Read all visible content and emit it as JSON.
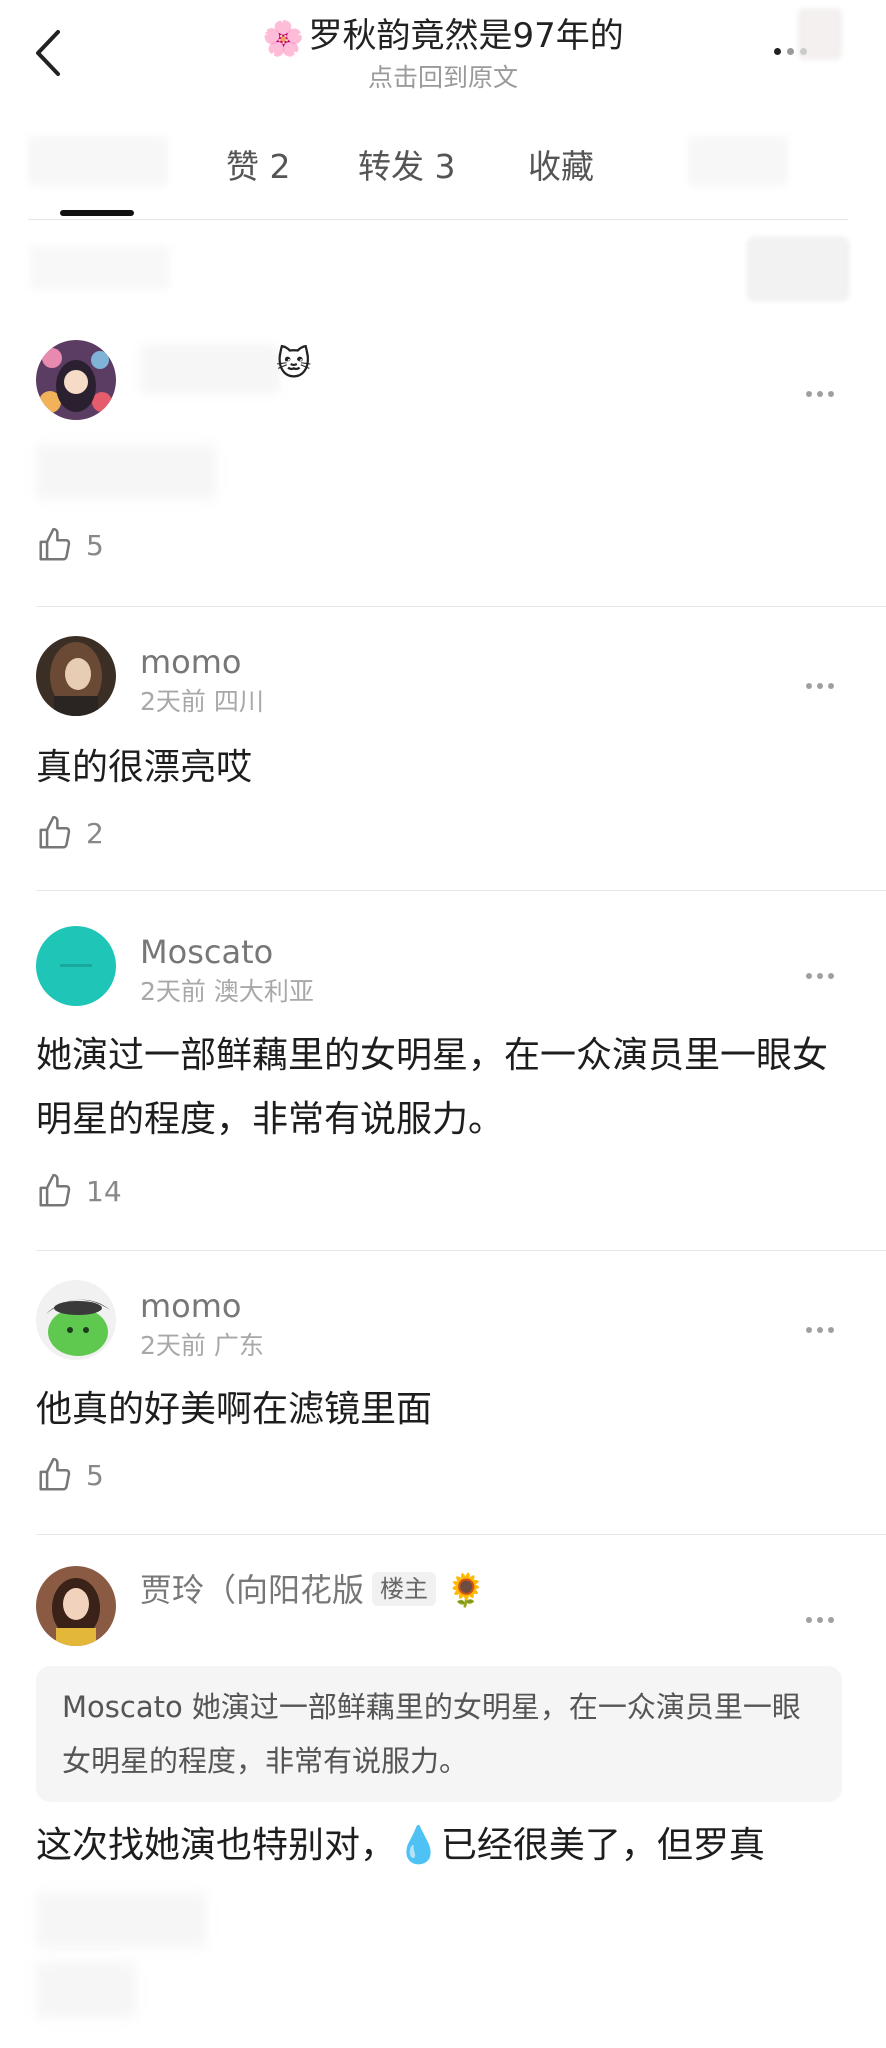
{
  "header": {
    "title": "罗秋韵竟然是97年的",
    "title_emoji": "🌸",
    "subtitle": "点击回到原文"
  },
  "tabs": [
    {
      "label": "赞 2"
    },
    {
      "label": "转发 3"
    },
    {
      "label": "收藏"
    }
  ],
  "comments": [
    {
      "name": "",
      "meta": "",
      "text": "",
      "likes": "5"
    },
    {
      "name": "momo",
      "meta": "2天前 四川",
      "text": "真的很漂亮哎",
      "likes": "2"
    },
    {
      "name": "Moscato",
      "meta": "2天前 澳大利亚",
      "text": "她演过一部鲜藕里的女明星，在一众演员里一眼女明星的程度，非常有说服力。",
      "likes": "14"
    },
    {
      "name": "momo",
      "meta": "2天前 广东",
      "text": "他真的好美啊在滤镜里面",
      "likes": "5"
    },
    {
      "name": "贾玲（向阳花版",
      "badge": "楼主",
      "quote": "Moscato 她演过一部鲜藕里的女明星，在一众演员里一眼女明星的程度，非常有说服力。",
      "text": "这次找她演也特别对，💧已经很美了，但罗真"
    }
  ],
  "colors": {
    "accent": "#111111",
    "avatar_moscato": "#1fc6b8"
  }
}
